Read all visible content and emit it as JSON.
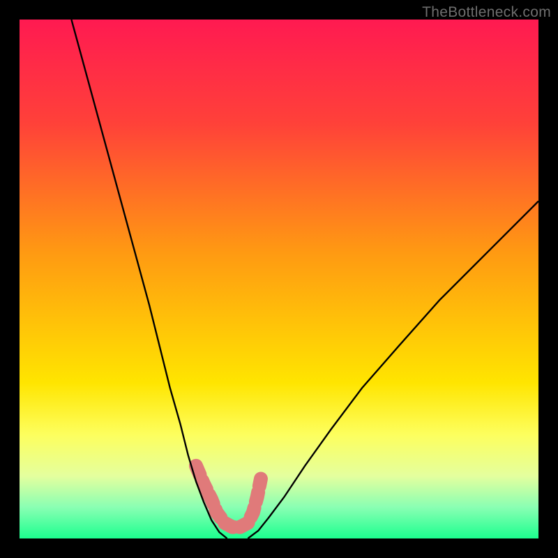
{
  "watermark": {
    "text": "TheBottleneck.com"
  },
  "chart_data": {
    "type": "line",
    "title": "",
    "xlabel": "",
    "ylabel": "",
    "xlim": [
      0,
      100
    ],
    "ylim": [
      0,
      100
    ],
    "grid": false,
    "background_gradient": {
      "stops": [
        {
          "pos": 0.0,
          "color": "#ff1a51"
        },
        {
          "pos": 0.2,
          "color": "#ff4139"
        },
        {
          "pos": 0.45,
          "color": "#ff9a12"
        },
        {
          "pos": 0.7,
          "color": "#ffe500"
        },
        {
          "pos": 0.8,
          "color": "#fdff5e"
        },
        {
          "pos": 0.88,
          "color": "#e4ff9e"
        },
        {
          "pos": 0.94,
          "color": "#89ffb3"
        },
        {
          "pos": 1.0,
          "color": "#1cff8f"
        }
      ]
    },
    "series": [
      {
        "name": "left-curve",
        "x": [
          10,
          13,
          16,
          19,
          22,
          25,
          27,
          29,
          31,
          32.5,
          34,
          35.5,
          37,
          38.5,
          40
        ],
        "y": [
          100,
          89,
          78,
          67,
          56,
          45,
          37,
          29,
          22,
          16,
          11,
          7,
          3.5,
          1.2,
          0
        ]
      },
      {
        "name": "right-curve",
        "x": [
          44,
          46,
          48,
          51,
          55,
          60,
          66,
          73,
          81,
          90,
          100
        ],
        "y": [
          0,
          1.5,
          4,
          8,
          14,
          21,
          29,
          37,
          46,
          55,
          65
        ]
      },
      {
        "name": "floor-salmon-band",
        "x": [
          34,
          35.5,
          37,
          38,
          39.5,
          41,
          42.5,
          44,
          45,
          45.8,
          46.5
        ],
        "y": [
          14,
          10.5,
          7.5,
          5,
          3,
          2.2,
          2.2,
          3,
          5,
          8,
          11.5
        ]
      }
    ],
    "salmon_marker_color": "#e07a7a",
    "curve_color": "#000000",
    "curve_width": 2.4
  }
}
